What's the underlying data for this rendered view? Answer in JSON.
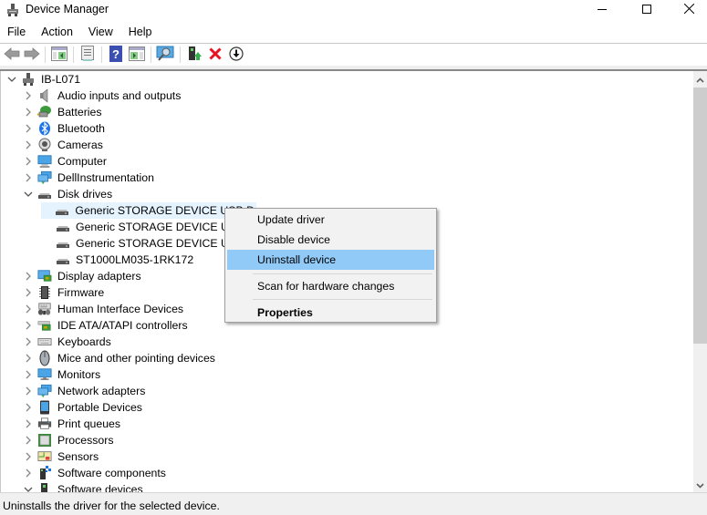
{
  "window": {
    "title": "Device Manager",
    "controls": {
      "minimize": "minimize",
      "maximize": "maximize",
      "close": "close"
    }
  },
  "menubar": [
    "File",
    "Action",
    "View",
    "Help"
  ],
  "toolbar": [
    {
      "name": "back-icon",
      "tooltip": "Back"
    },
    {
      "name": "forward-icon",
      "tooltip": "Forward"
    },
    {
      "name": "show-hide-console-tree-icon",
      "tooltip": "Show/Hide Console Tree"
    },
    {
      "name": "properties-icon",
      "tooltip": "Properties"
    },
    {
      "name": "help-icon",
      "tooltip": "Help"
    },
    {
      "name": "show-hide-action-pane-icon",
      "tooltip": "Show/Hide Action Pane"
    },
    {
      "name": "scan-hardware-icon",
      "tooltip": "Scan for hardware changes"
    },
    {
      "name": "update-driver-icon",
      "tooltip": "Update driver"
    },
    {
      "name": "uninstall-device-icon",
      "tooltip": "Uninstall device"
    },
    {
      "name": "disable-device-icon",
      "tooltip": "Disable device"
    }
  ],
  "tree": {
    "root": {
      "label": "IB-L071",
      "expanded": true
    },
    "items": [
      {
        "label": "Audio inputs and outputs",
        "icon": "speaker-icon",
        "expanded": false,
        "level": 1
      },
      {
        "label": "Batteries",
        "icon": "battery-icon",
        "expanded": false,
        "level": 1
      },
      {
        "label": "Bluetooth",
        "icon": "bluetooth-icon",
        "expanded": false,
        "level": 1
      },
      {
        "label": "Cameras",
        "icon": "camera-icon",
        "expanded": false,
        "level": 1
      },
      {
        "label": "Computer",
        "icon": "computer-icon",
        "expanded": false,
        "level": 1
      },
      {
        "label": "DellInstrumentation",
        "icon": "network-icon",
        "expanded": false,
        "level": 1
      },
      {
        "label": "Disk drives",
        "icon": "disk-drive-icon",
        "expanded": true,
        "level": 1
      },
      {
        "label": "Generic STORAGE DEVICE USB D",
        "icon": "disk-drive-icon",
        "level": 2,
        "selected": true
      },
      {
        "label": "Generic STORAGE DEVICE USB D",
        "icon": "disk-drive-icon",
        "level": 2
      },
      {
        "label": "Generic STORAGE DEVICE USB D",
        "icon": "disk-drive-icon",
        "level": 2
      },
      {
        "label": "ST1000LM035-1RK172",
        "icon": "disk-drive-icon",
        "level": 2
      },
      {
        "label": "Display adapters",
        "icon": "display-adapter-icon",
        "expanded": false,
        "level": 1
      },
      {
        "label": "Firmware",
        "icon": "firmware-chip-icon",
        "expanded": false,
        "level": 1
      },
      {
        "label": "Human Interface Devices",
        "icon": "hid-icon",
        "expanded": false,
        "level": 1
      },
      {
        "label": "IDE ATA/ATAPI controllers",
        "icon": "ide-controller-icon",
        "expanded": false,
        "level": 1
      },
      {
        "label": "Keyboards",
        "icon": "keyboard-icon",
        "expanded": false,
        "level": 1
      },
      {
        "label": "Mice and other pointing devices",
        "icon": "mouse-icon",
        "expanded": false,
        "level": 1
      },
      {
        "label": "Monitors",
        "icon": "monitor-icon",
        "expanded": false,
        "level": 1
      },
      {
        "label": "Network adapters",
        "icon": "network-icon",
        "expanded": false,
        "level": 1
      },
      {
        "label": "Portable Devices",
        "icon": "portable-device-icon",
        "expanded": false,
        "level": 1
      },
      {
        "label": "Print queues",
        "icon": "printer-icon",
        "expanded": false,
        "level": 1
      },
      {
        "label": "Processors",
        "icon": "processor-icon",
        "expanded": false,
        "level": 1
      },
      {
        "label": "Sensors",
        "icon": "sensor-icon",
        "expanded": false,
        "level": 1
      },
      {
        "label": "Software components",
        "icon": "software-component-icon",
        "expanded": false,
        "level": 1
      },
      {
        "label": "Software devices",
        "icon": "software-device-icon",
        "expanded": true,
        "level": 1
      }
    ]
  },
  "context_menu": {
    "items": [
      {
        "label": "Update driver"
      },
      {
        "label": "Disable device"
      },
      {
        "label": "Uninstall device",
        "highlighted": true
      },
      {
        "separator": true
      },
      {
        "label": "Scan for hardware changes"
      },
      {
        "separator": true
      },
      {
        "label": "Properties",
        "bold": true
      }
    ]
  },
  "statusbar": {
    "text": "Uninstalls the driver for the selected device."
  },
  "colors": {
    "selection": "#e5f3ff",
    "menu_highlight": "#91c9f7",
    "uninstall_red": "#e81123"
  }
}
